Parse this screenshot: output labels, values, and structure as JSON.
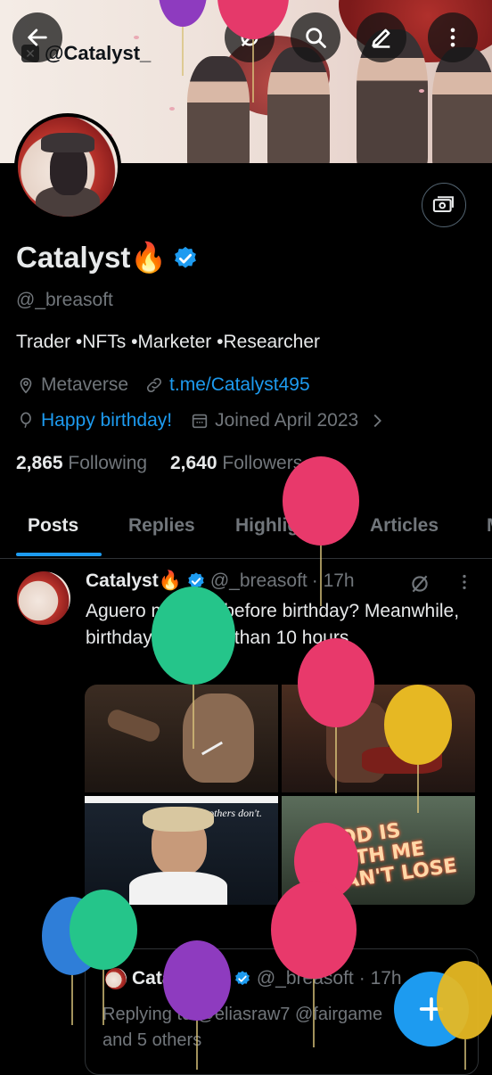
{
  "header": {
    "overlay_handle": "@Catalyst_",
    "back_icon": "arrow-left-icon",
    "search_icon": "search-icon",
    "edit_icon": "pencil-icon",
    "more_icon": "more-vertical-icon"
  },
  "profile": {
    "name": "Catalyst🔥",
    "handle": "@_breasoft",
    "bio": "Trader  •NFTs •Marketer •Researcher",
    "location": "Metaverse",
    "link": "t.me/Catalyst495",
    "birthday": "Happy birthday!",
    "joined": "Joined April 2023",
    "following_count": "2,865",
    "following_label": "Following",
    "followers_count": "2,640",
    "followers_label": "Followers"
  },
  "tabs": [
    "Posts",
    "Replies",
    "Highlights",
    "Articles"
  ],
  "post": {
    "name": "Catalyst🔥",
    "handle": "@_breasoft",
    "time": "· 17h",
    "text": "Aguero moment before birthday? Meanwhile, birthday is in less  than 10 hours",
    "image3_caption": "when others don't.",
    "image4_text": "GOD IS WITH ME CAN'T LOSE"
  },
  "quoted": {
    "name": "Catalyst🔥",
    "handle": "@_breasoft",
    "time": "· 17h",
    "reply": "Replying to @eliasraw7 @fairgame and 5 others"
  },
  "colors": {
    "accent": "#1d9bf0",
    "background": "#000000",
    "muted": "#71767b",
    "text": "#e7e9ea"
  }
}
